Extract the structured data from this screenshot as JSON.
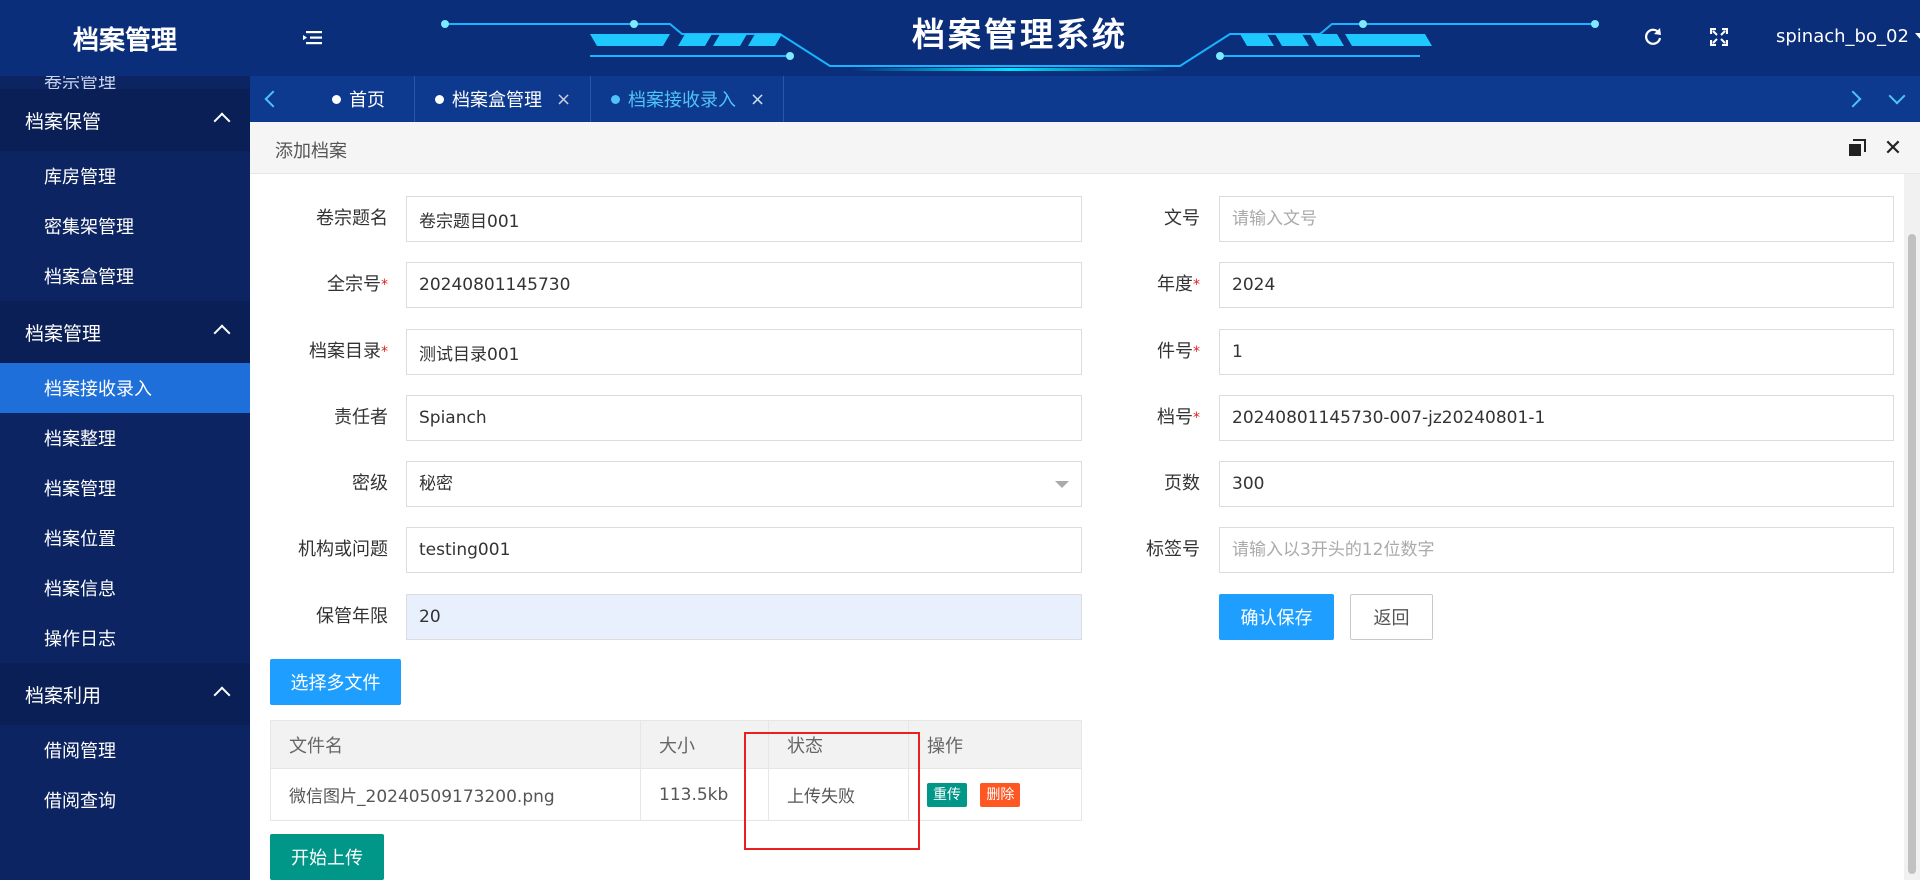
{
  "header": {
    "logo": "档案管理",
    "system_title": "档案管理系统",
    "username": "spinach_bo_02",
    "icons": [
      "menu-toggle-icon",
      "refresh-icon",
      "fullscreen-icon"
    ]
  },
  "sidebar": {
    "partial_top_item": "卷宗管理",
    "groups": [
      {
        "label": "档案保管",
        "items": [
          "库房管理",
          "密集架管理",
          "档案盒管理"
        ]
      },
      {
        "label": "档案管理",
        "items": [
          "档案接收录入",
          "档案整理",
          "档案管理",
          "档案位置",
          "档案信息",
          "操作日志"
        ]
      },
      {
        "label": "档案利用",
        "items": [
          "借阅管理",
          "借阅查询"
        ]
      }
    ],
    "active_item": "档案接收录入"
  },
  "tabs": [
    {
      "label": "首页",
      "closable": false
    },
    {
      "label": "档案盒管理",
      "closable": true
    },
    {
      "label": "档案接收录入",
      "closable": true,
      "active": true
    }
  ],
  "panel": {
    "title": "添加档案"
  },
  "form": {
    "left": [
      {
        "label": "卷宗题名",
        "required": false,
        "value": "卷宗题目001",
        "placeholder": ""
      },
      {
        "label": "全宗号",
        "required": true,
        "value": "20240801145730",
        "placeholder": ""
      },
      {
        "label": "档案目录",
        "required": true,
        "value": "测试目录001",
        "placeholder": ""
      },
      {
        "label": "责任者",
        "required": false,
        "value": "Spianch",
        "placeholder": ""
      },
      {
        "label": "密级",
        "required": false,
        "value": "秘密",
        "placeholder": "",
        "type": "select"
      },
      {
        "label": "机构或问题",
        "required": false,
        "value": "testing001",
        "placeholder": ""
      },
      {
        "label": "保管年限",
        "required": false,
        "value": "20",
        "placeholder": ""
      }
    ],
    "right": [
      {
        "label": "文号",
        "required": false,
        "value": "",
        "placeholder": "请输入文号"
      },
      {
        "label": "年度",
        "required": true,
        "value": "2024",
        "placeholder": ""
      },
      {
        "label": "件号",
        "required": true,
        "value": "1",
        "placeholder": ""
      },
      {
        "label": "档号",
        "required": true,
        "value": "20240801145730-007-jz20240801-1",
        "placeholder": ""
      },
      {
        "label": "页数",
        "required": false,
        "value": "300",
        "placeholder": ""
      },
      {
        "label": "标签号",
        "required": false,
        "value": "",
        "placeholder": "请输入以3开头的12位数字"
      }
    ],
    "save_label": "确认保存",
    "back_label": "返回"
  },
  "upload": {
    "choose_label": "选择多文件",
    "start_label": "开始上传",
    "columns": [
      "文件名",
      "大小",
      "状态",
      "操作"
    ],
    "rows": [
      {
        "name": "微信图片_20240509173200.png",
        "size": "113.5kb",
        "status": "上传失败",
        "retry": "重传",
        "delete": "删除"
      }
    ]
  },
  "colors": {
    "header_bg": "#0a2e79",
    "sidebar_bg": "#0c2462",
    "active_item": "#1e6fd9",
    "primary_btn": "#1e9fff",
    "green_btn": "#009688",
    "danger": "#ff5722",
    "highlight_box": "#e82020"
  }
}
